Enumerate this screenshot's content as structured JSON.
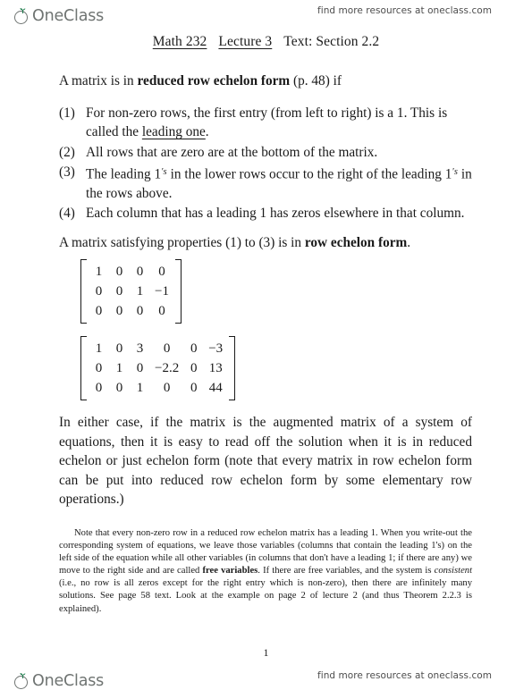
{
  "watermark": {
    "brand_name": "OneClass",
    "tagline": "find more resources at oneclass.com"
  },
  "document": {
    "title": {
      "course": "Math 232",
      "lecture": "Lecture 3",
      "text_ref": "Text: Section 2.2"
    },
    "intro": {
      "before_bold": "A matrix is in ",
      "bold": "reduced row echelon form",
      "after_bold": " (p. 48) if"
    },
    "definition_items": [
      {
        "number": "(1)",
        "text_a": "For non-zero rows, the first entry (from left to right) is a 1. This is called the ",
        "underlined": "leading one",
        "text_b": "."
      },
      {
        "number": "(2)",
        "text_a": "All rows that are zero are at the bottom of the matrix.",
        "underlined": "",
        "text_b": ""
      },
      {
        "number": "(3)",
        "text_a": "The leading 1",
        "primes": "'s",
        "text_mid": " in the lower rows occur to the right of the leading 1",
        "primes2": "'s",
        "text_b": " in the rows above."
      },
      {
        "number": "(4)",
        "text_a": "Each column that has a leading 1 has zeros elsewhere in that column.",
        "underlined": "",
        "text_b": ""
      }
    ],
    "row_echelon_line": {
      "before_bold": "A matrix satisfying properties (1) to (3) is in ",
      "bold": "row echelon form",
      "after_bold": "."
    },
    "matrices": [
      {
        "name": "matrix-reduced-row-echelon-example-1",
        "rows": [
          [
            "1",
            "0",
            "0",
            "0"
          ],
          [
            "0",
            "0",
            "1",
            "−1"
          ],
          [
            "0",
            "0",
            "0",
            "0"
          ]
        ]
      },
      {
        "name": "matrix-reduced-row-echelon-example-2",
        "rows": [
          [
            "1",
            "0",
            "3",
            "0",
            "0",
            "−3"
          ],
          [
            "0",
            "1",
            "0",
            "−2.2",
            "0",
            "13"
          ],
          [
            "0",
            "0",
            "1",
            "0",
            "0",
            "44"
          ]
        ]
      }
    ],
    "closing_paragraph": "In either case, if the matrix is the augmented matrix of a system of equations, then it is easy to read off the solution when it is in reduced echelon or just echelon form (note that every matrix in row echelon form can be put into reduced row echelon form by some elementary row operations.)",
    "note": {
      "part1": "Note that every non-zero row in a reduced row echelon matrix has a leading 1. When you write-out the corresponding system of equations, we leave those variables (columns that contain the leading 1's) on the left side of the equation while all other variables (in columns that don't have a leading 1; if there are any) we move to the right side and are called ",
      "bold1": "free variables",
      "part2": ". If there are free variables, and the system is ",
      "italic1": "consistent",
      "part3": " (i.e., no row is all zeros except for the right entry which is non-zero), then there are infinitely many solutions. See page 58 text. Look at the example on page 2 of lecture 2 (and thus Theorem 2.2.3 is explained)."
    },
    "page_number": "1"
  },
  "colors": {
    "brand_gray": "#6f7472",
    "leaf_green": "#1f7a4d",
    "text": "#1a1a1a"
  }
}
